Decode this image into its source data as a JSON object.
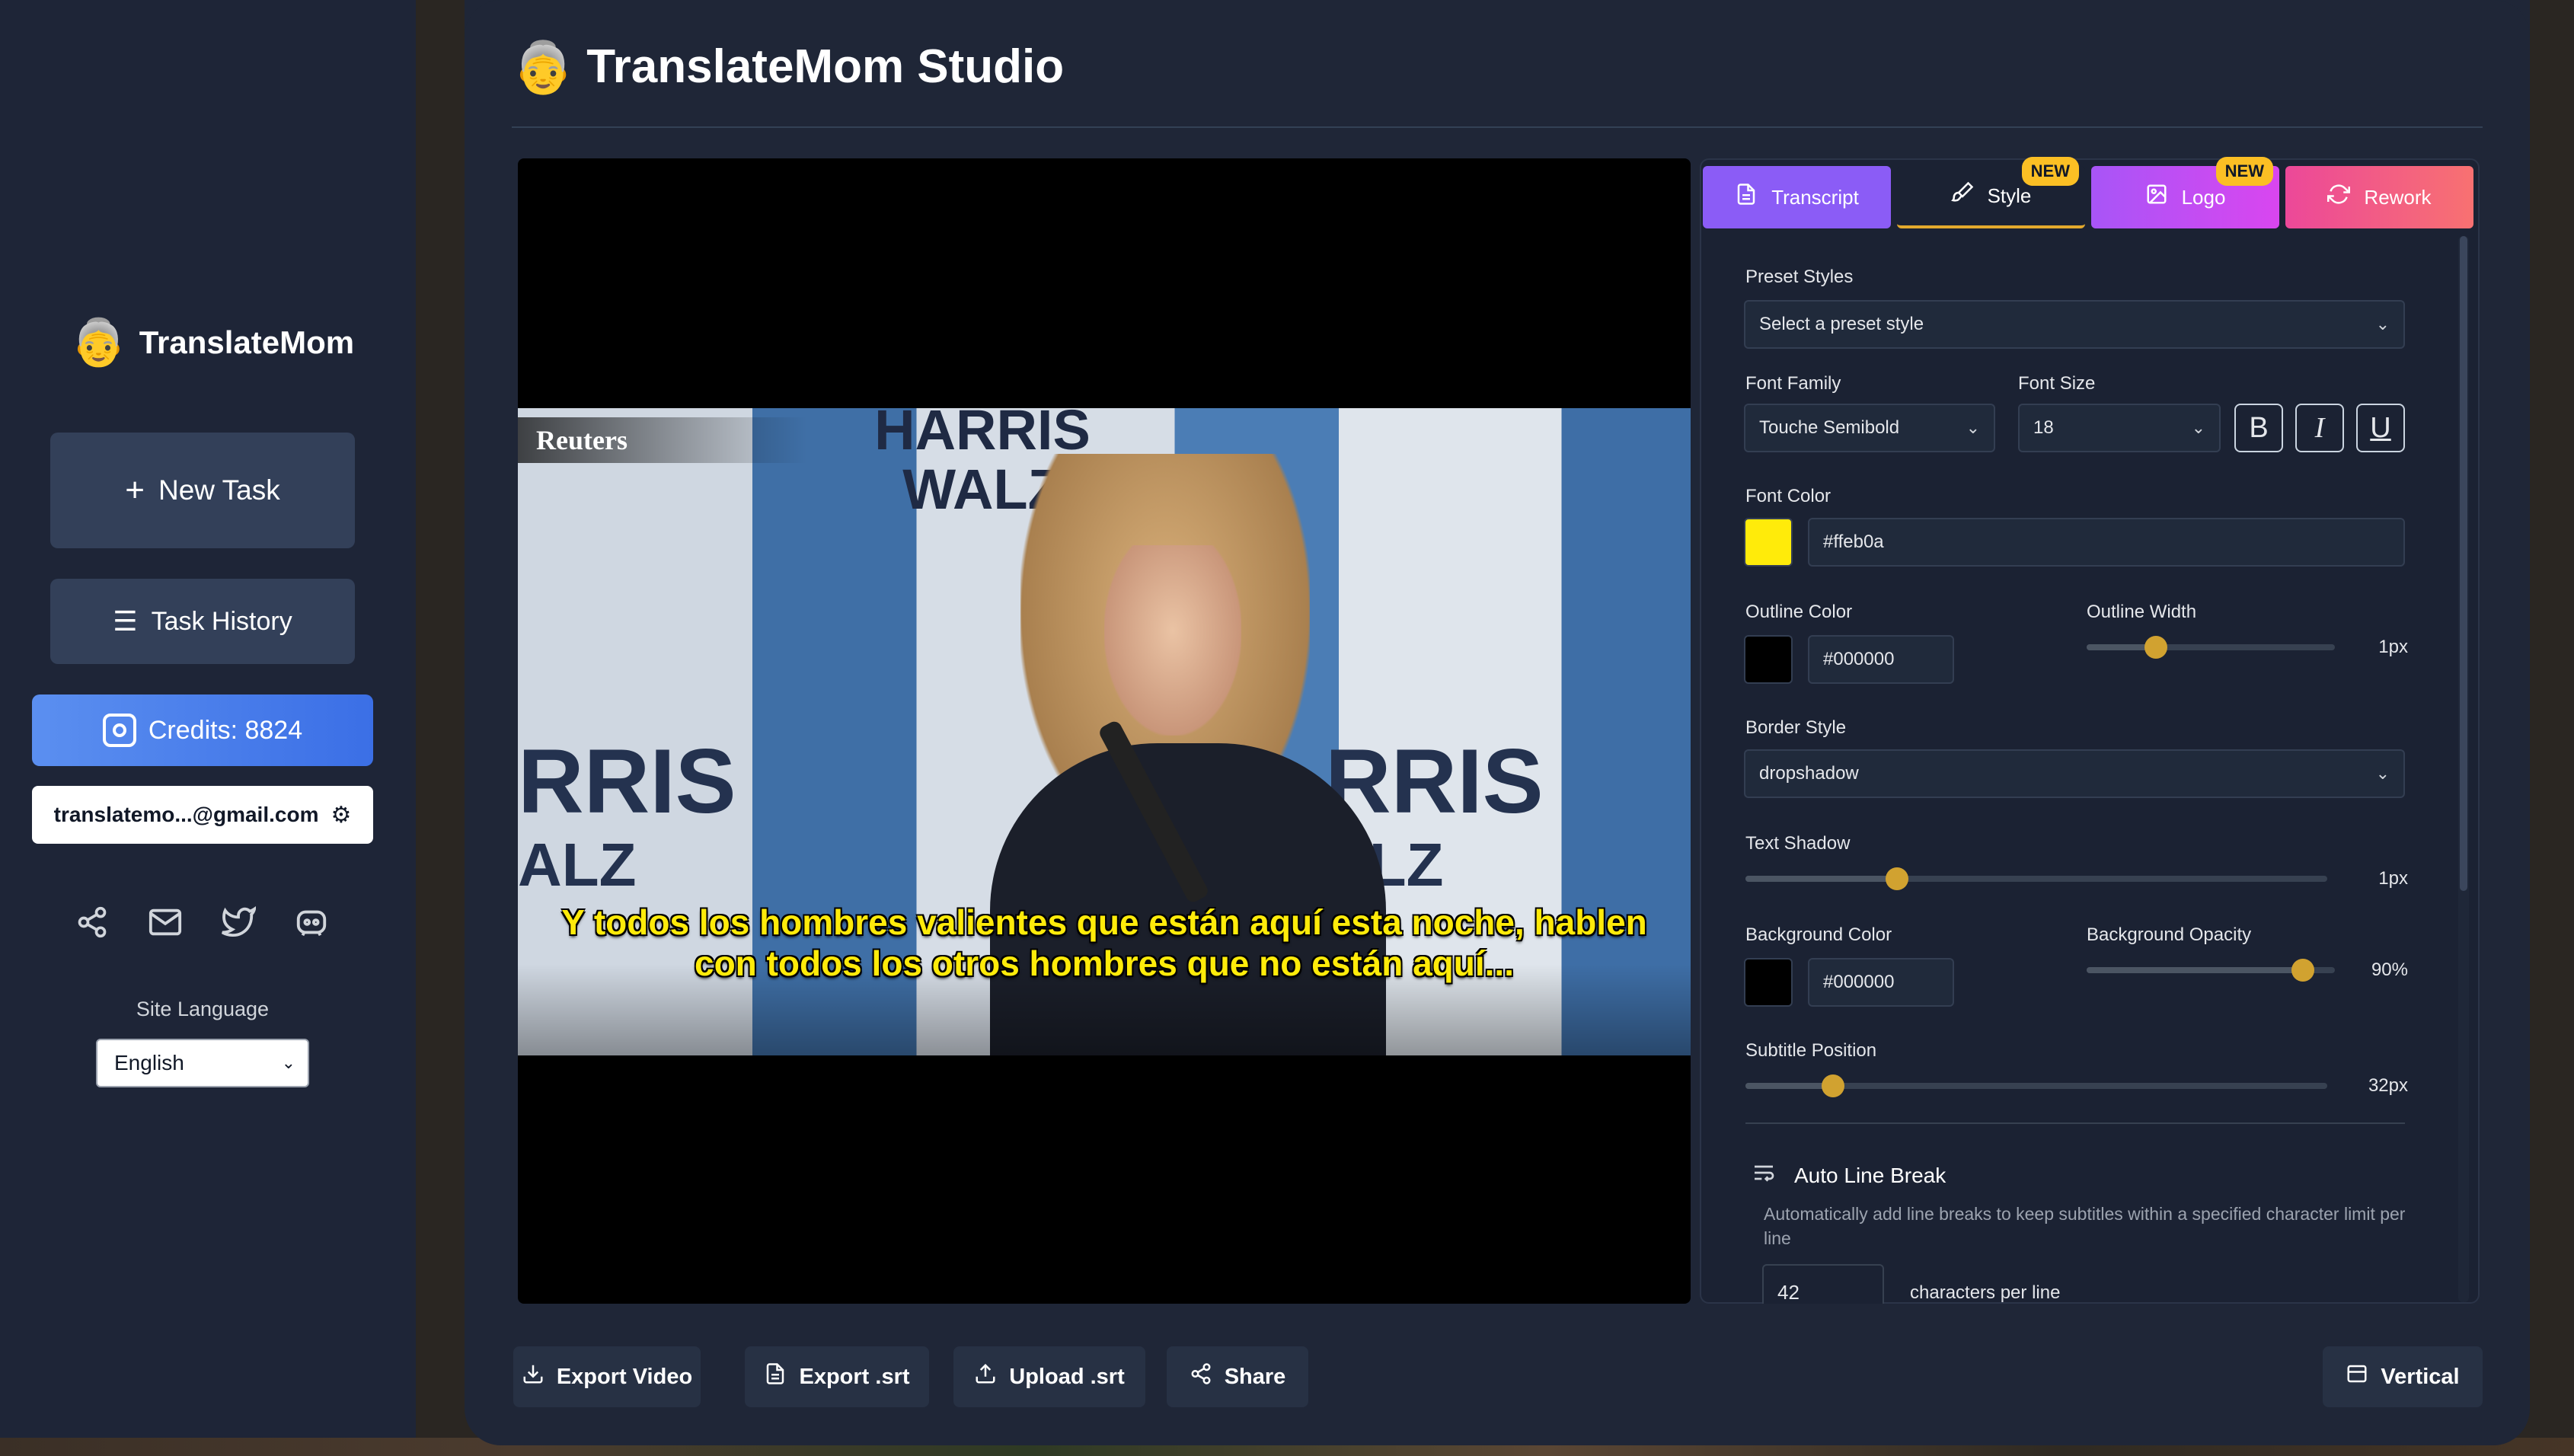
{
  "sidebar": {
    "brand": {
      "emoji": "👵",
      "name": "TranslateMom"
    },
    "new_task": {
      "icon": "+",
      "label": "New Task"
    },
    "task_history": {
      "icon": "☰",
      "label": "Task History"
    },
    "credits": "Credits: 8824",
    "email": "translatemo...@gmail.com",
    "email_icon": "gear-icon",
    "socials": [
      "share-icon",
      "mail-icon",
      "twitter-icon",
      "discord-icon"
    ],
    "site_language_label": "Site Language",
    "site_language_value": "English"
  },
  "header": {
    "emoji": "👵",
    "title": "TranslateMom Studio"
  },
  "video": {
    "watermark": "Reuters",
    "banner_top": "HARRIS WALZ",
    "banner_left_line1": "RRIS",
    "banner_left_line2": "ALZ",
    "banner_right_line1": "RRIS",
    "banner_right_line2": "ALZ",
    "subtitle_line1": "Y todos los hombres valientes que están aquí esta noche, hablen",
    "subtitle_line2": "con todos los otros hombres que no están aquí...",
    "subtitle_color": "#ffeb0a"
  },
  "tabs": [
    {
      "label": "Transcript",
      "icon": "document-icon"
    },
    {
      "label": "Style",
      "icon": "brush-icon",
      "badge": "NEW",
      "active": true
    },
    {
      "label": "Logo",
      "icon": "image-icon",
      "badge": "NEW"
    },
    {
      "label": "Rework",
      "icon": "refresh-icon"
    }
  ],
  "style_panel": {
    "preset_label": "Preset Styles",
    "preset_placeholder": "Select a preset style",
    "font_family_label": "Font Family",
    "font_family_value": "Touche Semibold",
    "font_size_label": "Font Size",
    "font_size_value": "18",
    "bold": "B",
    "italic": "I",
    "underline": "U",
    "font_color_label": "Font Color",
    "font_color_value": "#ffeb0a",
    "outline_color_label": "Outline Color",
    "outline_color_value": "#000000",
    "outline_width_label": "Outline Width",
    "outline_width_value": "1px",
    "outline_width_level": 0.28,
    "border_style_label": "Border Style",
    "border_style_value": "dropshadow",
    "text_shadow_label": "Text Shadow",
    "text_shadow_value": "1px",
    "text_shadow_level": 0.26,
    "bg_color_label": "Background Color",
    "bg_color_value": "#000000",
    "bg_opacity_label": "Background Opacity",
    "bg_opacity_value": "90%",
    "bg_opacity_level": 0.87,
    "subtitle_position_label": "Subtitle Position",
    "subtitle_position_value": "32px",
    "subtitle_position_level": 0.15,
    "auto_line_break_title": "Auto Line Break",
    "auto_line_break_desc": "Automatically add line breaks to keep subtitles within a specified character limit per line",
    "chars_value": "42",
    "chars_label": "characters per line"
  },
  "toolbar": {
    "export_video": "Export Video",
    "export_srt": "Export .srt",
    "upload_srt": "Upload .srt",
    "share": "Share",
    "vertical": "Vertical"
  },
  "colors": {
    "accent": "#d1a230",
    "sidebar_bg": "#1e2537",
    "main_bg": "#1f2637",
    "credits_blue": "#4a7ff0"
  }
}
